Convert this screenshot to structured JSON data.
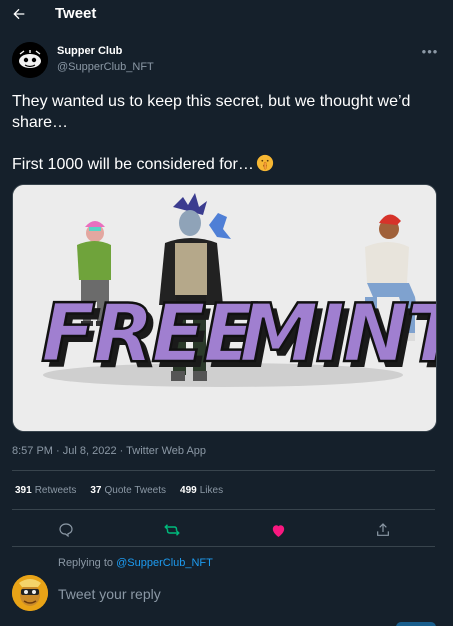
{
  "header": {
    "title": "Tweet"
  },
  "tweet": {
    "author_name": "Supper Club",
    "author_handle": "@SupperClub_NFT",
    "text_line1": "They wanted us to keep this secret, but we thought we’d share…",
    "text_line2": "First 1000 will be considered for…",
    "emoji": "shushing-face",
    "media_text_left": "FREE",
    "media_text_right": "MINT",
    "timestamp": "8:57 PM · Jul 8, 2022 · Twitter Web App"
  },
  "stats": {
    "retweets_count": "391",
    "retweets_label": "Retweets",
    "quotes_count": "37",
    "quotes_label": "Quote Tweets",
    "likes_count": "499",
    "likes_label": "Likes"
  },
  "actions": {
    "liked": true,
    "like_color": "#f91880",
    "retweet_color": "#00ba7c"
  },
  "reply": {
    "replying_to_prefix": "Replying to",
    "replying_to_handle": "@SupperClub_NFT",
    "placeholder": "Tweet your reply"
  },
  "colors": {
    "background": "#15202b",
    "accent": "#1d9bf0",
    "secondary_text": "#8b98a5",
    "border": "#38444d",
    "mint_purple": "#a07fd0"
  }
}
